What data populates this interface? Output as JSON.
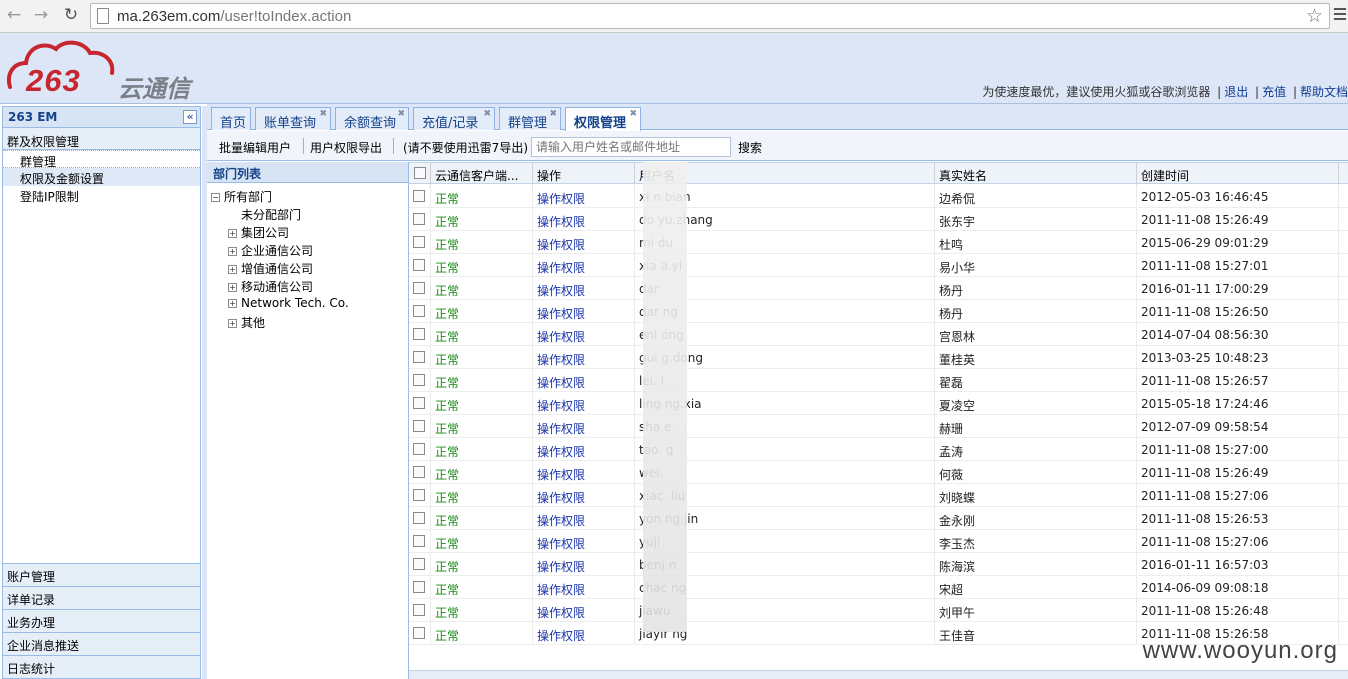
{
  "browser": {
    "url_host": "ma.263em.com",
    "url_path": "/user!toIndex.action"
  },
  "logo": {
    "number": "263",
    "text": "云通信"
  },
  "top_links": {
    "notice": "为使速度最优，建议使用火狐或谷歌浏览器",
    "exit": "退出",
    "recharge": "充值",
    "help": "帮助文档"
  },
  "sidebar": {
    "title": "263 EM",
    "group": "群及权限管理",
    "items": [
      {
        "label": "群管理"
      },
      {
        "label": "权限及金额设置"
      },
      {
        "label": "登陆IP限制"
      }
    ],
    "bottom_groups": [
      {
        "label": "账户管理"
      },
      {
        "label": "详单记录"
      },
      {
        "label": "业务办理"
      },
      {
        "label": "企业消息推送"
      },
      {
        "label": "日志统计"
      }
    ]
  },
  "tabs": [
    {
      "label": "首页"
    },
    {
      "label": "账单查询"
    },
    {
      "label": "余额查询"
    },
    {
      "label": "充值/记录"
    },
    {
      "label": "群管理"
    },
    {
      "label": "权限管理"
    }
  ],
  "toolbar": {
    "batch_edit": "批量编辑用户",
    "export": "用户权限导出",
    "export_note": "(请不要使用迅雷7导出)",
    "search_placeholder": "请输入用户姓名或邮件地址",
    "search": "搜索"
  },
  "dept": {
    "title": "部门列表",
    "root": "所有部门",
    "nodes": [
      {
        "label": "未分配部门"
      },
      {
        "label": "集团公司"
      },
      {
        "label": "企业通信公司"
      },
      {
        "label": "增值通信公司"
      },
      {
        "label": "移动通信公司"
      },
      {
        "label": "Network Tech. Co."
      },
      {
        "label": "其他"
      }
    ]
  },
  "grid": {
    "columns": [
      "云通信客户端...",
      "操作",
      "用户名",
      "真实姓名",
      "创建时间"
    ],
    "rows": [
      {
        "status": "正常",
        "op": "操作权限",
        "user": "xi      n.bian",
        "name": "边希侃",
        "time": "2012-05-03 16:46:45"
      },
      {
        "status": "正常",
        "op": "操作权限",
        "user": "do      yu.zhang",
        "name": "张东宇",
        "time": "2011-11-08 15:26:49"
      },
      {
        "status": "正常",
        "op": "操作权限",
        "user": "mi      du",
        "name": "杜鸣",
        "time": "2015-06-29 09:01:29"
      },
      {
        "status": "正常",
        "op": "操作权限",
        "user": "xia      a.yi",
        "name": "易小华",
        "time": "2011-11-08 15:27:01"
      },
      {
        "status": "正常",
        "op": "操作权限",
        "user": "dar",
        "name": "杨丹",
        "time": "2016-01-11 17:00:29"
      },
      {
        "status": "正常",
        "op": "操作权限",
        "user": "dar      ng",
        "name": "杨丹",
        "time": "2011-11-08 15:26:50"
      },
      {
        "status": "正常",
        "op": "操作权限",
        "user": "enl      ong",
        "name": "宫恩林",
        "time": "2014-07-04 08:56:30"
      },
      {
        "status": "正常",
        "op": "操作权限",
        "user": "gui      g.dong",
        "name": "董桂英",
        "time": "2013-03-25 10:48:23"
      },
      {
        "status": "正常",
        "op": "操作权限",
        "user": "lei.      i",
        "name": "翟磊",
        "time": "2011-11-08 15:26:57"
      },
      {
        "status": "正常",
        "op": "操作权限",
        "user": "ling      ng.xia",
        "name": "夏凌空",
        "time": "2015-05-18 17:24:46"
      },
      {
        "status": "正常",
        "op": "操作权限",
        "user": "sha      e",
        "name": "赫珊",
        "time": "2012-07-09 09:58:54"
      },
      {
        "status": "正常",
        "op": "操作权限",
        "user": "tao.      g",
        "name": "孟涛",
        "time": "2011-11-08 15:27:00"
      },
      {
        "status": "正常",
        "op": "操作权限",
        "user": "wei.",
        "name": "何薇",
        "time": "2011-11-08 15:26:49"
      },
      {
        "status": "正常",
        "op": "操作权限",
        "user": "xiac      .liu",
        "name": "刘晓蝶",
        "time": "2011-11-08 15:27:06"
      },
      {
        "status": "正常",
        "op": "操作权限",
        "user": "yon      ng.jin",
        "name": "金永刚",
        "time": "2011-11-08 15:26:53"
      },
      {
        "status": "正常",
        "op": "操作权限",
        "user": "yuji",
        "name": "李玉杰",
        "time": "2011-11-08 15:27:06"
      },
      {
        "status": "正常",
        "op": "操作权限",
        "user": "benj      n",
        "name": "陈海滨",
        "time": "2016-01-11 16:57:03"
      },
      {
        "status": "正常",
        "op": "操作权限",
        "user": "chac      ng",
        "name": "宋超",
        "time": "2014-06-09 09:08:18"
      },
      {
        "status": "正常",
        "op": "操作权限",
        "user": "jiawu",
        "name": "刘甲午",
        "time": "2011-11-08 15:26:48"
      },
      {
        "status": "正常",
        "op": "操作权限",
        "user": "jiayir      ng",
        "name": "王佳音",
        "time": "2011-11-08 15:26:58"
      }
    ]
  },
  "watermark": "www.wooyun.org",
  "colors": {
    "status_ok": "#1b8a16",
    "link_blue": "#1934a8",
    "brand_red": "#c7262f"
  }
}
